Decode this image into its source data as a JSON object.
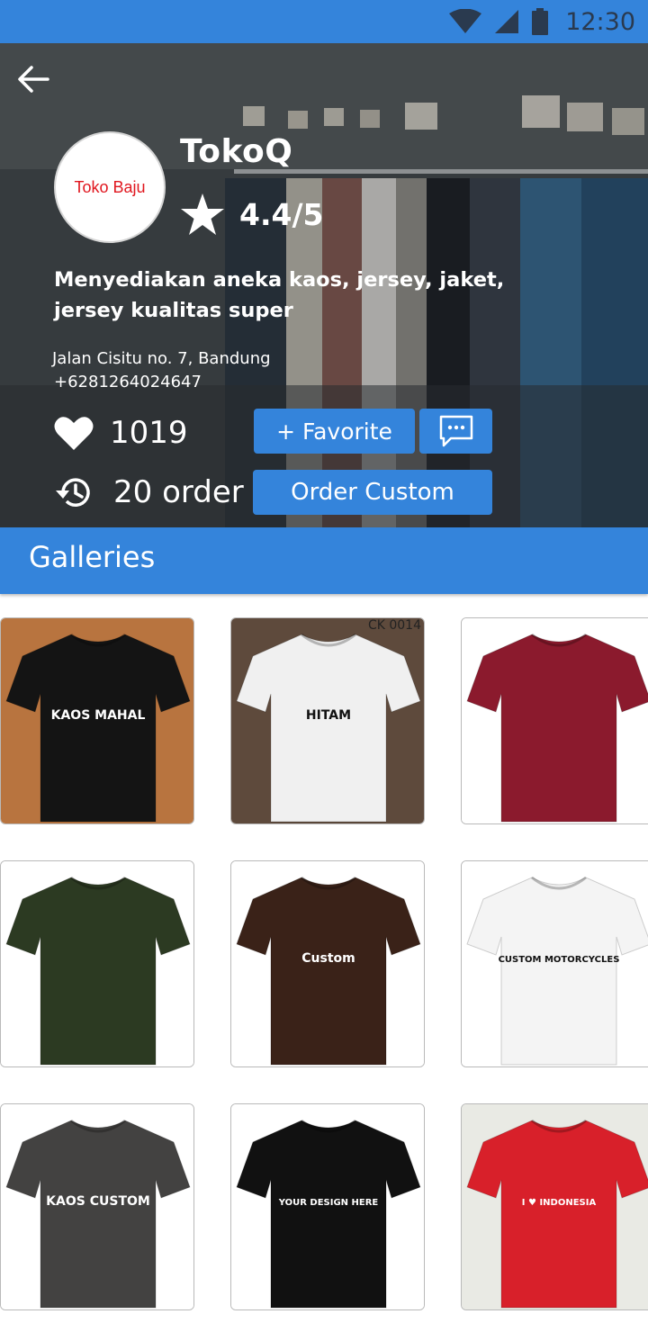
{
  "status_bar": {
    "time": "12:30",
    "icons": [
      "wifi-icon",
      "signal-icon",
      "battery-icon"
    ]
  },
  "header": {
    "back_icon": "arrow-left-icon",
    "logo_text": "Toko Baju",
    "store_name": "TokoQ",
    "rating": "4.4/5",
    "description": "Menyediakan aneka kaos, jersey, jaket, jersey kualitas super",
    "address": "Jalan Cisitu no. 7, Bandung",
    "phone": "+6281264024647",
    "likes": "1019",
    "orders": "20 order",
    "favorite_label": "+ Favorite",
    "chat_icon": "chat-bubble-icon",
    "order_custom_label": "Order Custom"
  },
  "galleries": {
    "title": "Galleries",
    "items": [
      {
        "shirt_color": "#141414",
        "bg": "#b8743f",
        "print": "KAOS MAHAL"
      },
      {
        "shirt_color": "#f0f0f0",
        "bg": "#5e4a3c",
        "print": "HITAM",
        "tag": "CK 0014"
      },
      {
        "shirt_color": "#8b1a2d",
        "bg": "#ffffff",
        "print": ""
      },
      {
        "shirt_color": "#2c3a22",
        "bg": "#ffffff",
        "print": ""
      },
      {
        "shirt_color": "#3a2218",
        "bg": "#ffffff",
        "print": "Custom"
      },
      {
        "shirt_color": "#f4f4f4",
        "bg": "#ffffff",
        "print": "CUSTOM MOTORCYCLES"
      },
      {
        "shirt_color": "#434241",
        "bg": "#ffffff",
        "print": "KAOS CUSTOM"
      },
      {
        "shirt_color": "#111111",
        "bg": "#ffffff",
        "print": "YOUR DESIGN HERE"
      },
      {
        "shirt_color": "#d8202a",
        "bg": "#e9eae4",
        "print": "I ♥ INDONESIA"
      }
    ]
  },
  "colors": {
    "primary": "#3484db",
    "logo_text": "#e0161e"
  }
}
